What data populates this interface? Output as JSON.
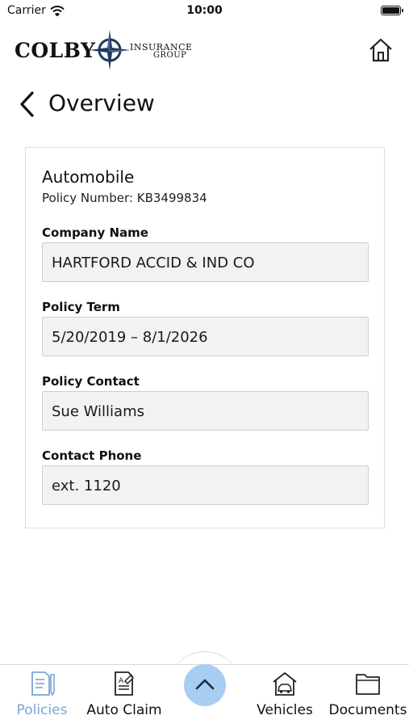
{
  "status_bar": {
    "carrier": "Carrier",
    "time": "10:00"
  },
  "header": {
    "logo_word": "COLBY",
    "logo_line1": "INSURANCE",
    "logo_line2": "GROUP"
  },
  "page": {
    "title": "Overview"
  },
  "policy": {
    "type": "Automobile",
    "number_label": "Policy Number:",
    "number": "KB3499834",
    "fields": [
      {
        "label": "Company Name",
        "value": "HARTFORD ACCID & IND CO"
      },
      {
        "label": "Policy Term",
        "value": "5/20/2019 – 8/1/2026"
      },
      {
        "label": "Policy Contact",
        "value": "Sue Williams"
      },
      {
        "label": "Contact Phone",
        "value": "ext. 1120"
      }
    ]
  },
  "nav": {
    "items": [
      {
        "label": "Policies",
        "icon": "policies-icon",
        "active": true
      },
      {
        "label": "Auto Claim",
        "icon": "auto-claim-icon",
        "active": false
      },
      {
        "label": "Vehicles",
        "icon": "vehicles-icon",
        "active": false
      },
      {
        "label": "Documents",
        "icon": "documents-icon",
        "active": false
      }
    ]
  },
  "colors": {
    "accent": "#7aa6d6",
    "fab": "#a8cdf2",
    "field_bg": "#f2f2f2",
    "logo_navy": "#1f3a5f"
  }
}
